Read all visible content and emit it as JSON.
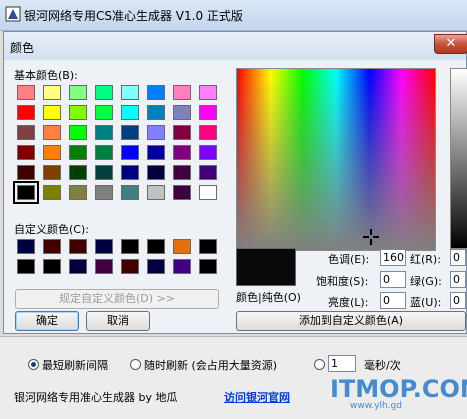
{
  "app": {
    "title": "银河网络专用CS准心生成器 V1.0 正式版",
    "mode_shortest": "最短刷新间隔",
    "mode_random": "随时刷新 (会占用大量资源)",
    "interval_value": "1",
    "interval_unit": "毫秒/次",
    "footer_credit": "银河网络专用准心生成器 by 地瓜",
    "footer_link": "访问银河官网",
    "watermark": "ITMOP.COM",
    "watermark_sub": "www.ylh.gd"
  },
  "dialog": {
    "title": "颜色",
    "close_glyph": "✕",
    "basic_label": "基本颜色(B):",
    "custom_label": "自定义颜色(C):",
    "define_custom_button": "规定自定义颜色(D) >>",
    "ok_button": "确定",
    "cancel_button": "取消",
    "add_custom_button": "添加到自定义颜色(A)",
    "preview_label": "颜色|纯色(O)",
    "hue_label": "色调(E):",
    "hue_value": "160",
    "sat_label": "饱和度(S):",
    "sat_value": "0",
    "lum_label": "亮度(L):",
    "lum_value": "0",
    "red_label": "红(R):",
    "red_value": "0",
    "green_label": "绿(G):",
    "green_value": "0",
    "blue_label": "蓝(U):",
    "blue_value": "0",
    "selected_swatch_index": 40,
    "basic_colors": [
      "#ff8080",
      "#ffff80",
      "#80ff80",
      "#00ff80",
      "#80ffff",
      "#0080ff",
      "#ff80c0",
      "#ff80ff",
      "#ff0000",
      "#ffff00",
      "#80ff00",
      "#00ff40",
      "#00ffff",
      "#0080c0",
      "#8080c0",
      "#ff00ff",
      "#804040",
      "#ff8040",
      "#00ff00",
      "#008080",
      "#004080",
      "#8080ff",
      "#800040",
      "#ff0080",
      "#800000",
      "#ff8000",
      "#008000",
      "#008040",
      "#0000ff",
      "#0000a0",
      "#800080",
      "#8000ff",
      "#400000",
      "#804000",
      "#004000",
      "#004040",
      "#000080",
      "#000040",
      "#400040",
      "#400080",
      "#000000",
      "#808000",
      "#808040",
      "#808080",
      "#408080",
      "#c0c0c0",
      "#400040",
      "#ffffff"
    ],
    "custom_colors": [
      "#000040",
      "#400000",
      "#400000",
      "#000040",
      "#000000",
      "#000000",
      "#e07010",
      "#000000",
      "#000000",
      "#000000",
      "#000040",
      "#400040",
      "#400000",
      "#000040",
      "#400080",
      "#000000"
    ]
  }
}
